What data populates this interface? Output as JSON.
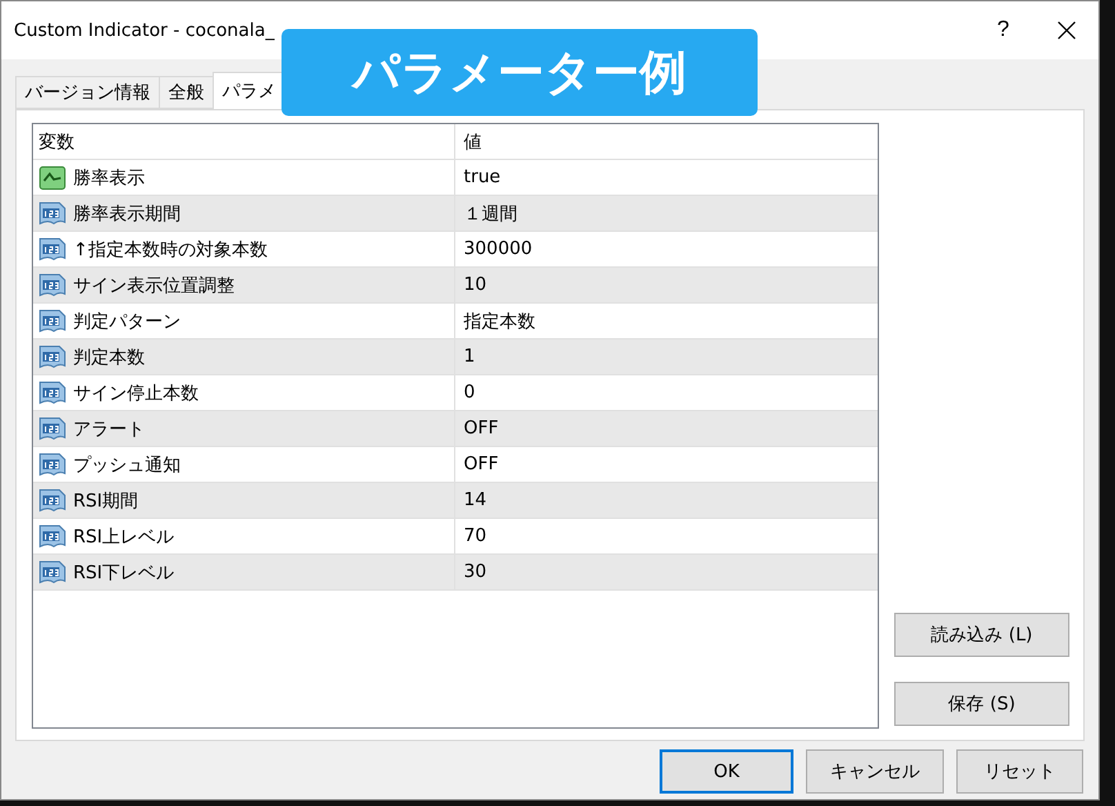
{
  "window": {
    "title": "Custom Indicator - coconala_",
    "help": "?"
  },
  "overlay": {
    "label": "パラメーター例"
  },
  "tabs": [
    {
      "label": "バージョン情報",
      "selected": false
    },
    {
      "label": "全般",
      "selected": false
    },
    {
      "label": "パラメ",
      "selected": true
    }
  ],
  "table": {
    "columns": [
      "変数",
      "値"
    ],
    "rows": [
      {
        "kind": "bool",
        "name": "勝率表示",
        "value": "true"
      },
      {
        "kind": "number",
        "name": "勝率表示期間",
        "value": "１週間"
      },
      {
        "kind": "number",
        "name": "↑指定本数時の対象本数",
        "value": "300000"
      },
      {
        "kind": "number",
        "name": "サイン表示位置調整",
        "value": "10"
      },
      {
        "kind": "number",
        "name": "判定パターン",
        "value": "指定本数"
      },
      {
        "kind": "number",
        "name": "判定本数",
        "value": "1"
      },
      {
        "kind": "number",
        "name": "サイン停止本数",
        "value": "0"
      },
      {
        "kind": "number",
        "name": "アラート",
        "value": "OFF"
      },
      {
        "kind": "number",
        "name": "プッシュ通知",
        "value": "OFF"
      },
      {
        "kind": "number",
        "name": "RSI期間",
        "value": "14"
      },
      {
        "kind": "number",
        "name": "RSI上レベル",
        "value": "70"
      },
      {
        "kind": "number",
        "name": "RSI下レベル",
        "value": "30"
      }
    ]
  },
  "side_buttons": [
    "読み込み (L)",
    "保存 (S)"
  ],
  "buttons": [
    {
      "label": "OK",
      "default": true
    },
    {
      "label": "キャンセル",
      "default": false
    },
    {
      "label": "リセット",
      "default": false
    }
  ]
}
